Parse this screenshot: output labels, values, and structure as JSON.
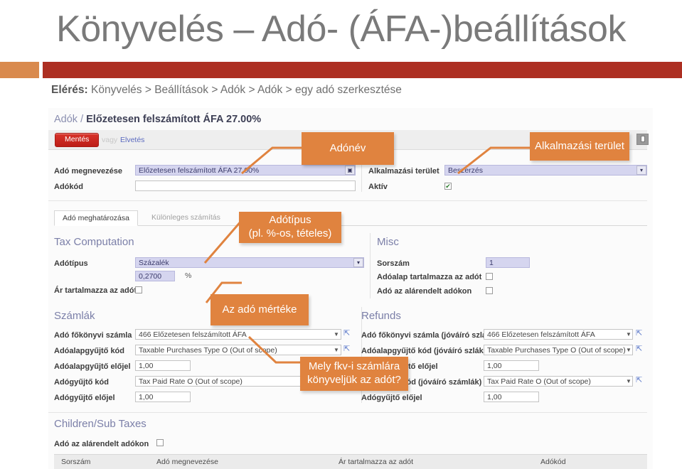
{
  "slide": {
    "title": "Könyvelés – Adó- (ÁFA-)beállítások",
    "access_label": "Elérés:",
    "access_path": "Könyvelés > Beállítások > Adók > Adók > egy adó szerkesztése",
    "accent_color": "#d98a4e",
    "bar_color": "#ad2f22",
    "callout_color": "#e0833f"
  },
  "app": {
    "breadcrumb": {
      "parent": "Adók / ",
      "current": "Előzetesen felszámított ÁFA 27.00%"
    },
    "toolbar": {
      "save_label": "Mentés",
      "or_label": "vagy",
      "discard_label": "Elvetés"
    },
    "header_form": {
      "tax_name_label": "Adó megnevezése",
      "tax_name_value": "Előzetesen felszámított ÁFA 27.00%",
      "tax_code_label": "Adókód",
      "tax_code_value": "",
      "scope_label": "Alkalmazási terület",
      "scope_value": "Beszerzés",
      "active_label": "Aktív",
      "active_checked": "✔"
    },
    "tabs": [
      {
        "label": "Adó meghatározása",
        "active": true
      },
      {
        "label": "Különleges számítás",
        "active": false
      }
    ],
    "tax_computation": {
      "section_title": "Tax Computation",
      "type_label": "Adótípus",
      "type_value": "Százalék",
      "rate_value": "0,2700",
      "rate_unit": "%",
      "price_includes_label": "Ár tartalmazza az adót"
    },
    "misc": {
      "section_title": "Misc",
      "sequence_label": "Sorszám",
      "sequence_value": "1",
      "base_includes_label": "Adóalap tartalmazza az adót",
      "children_label": "Adó az alárendelt adókon"
    },
    "invoices": {
      "section_title": "Számlák",
      "rows": [
        {
          "label": "Adó főkönyvi számla",
          "value": "466 Előzetesen felszámított ÁFA",
          "kind": "select"
        },
        {
          "label": "Adóalapgyűjtő kód",
          "value": "Taxable Purchases Type O (Out of scope)",
          "kind": "select"
        },
        {
          "label": "Adóalapgyűjtő előjel",
          "value": "1,00",
          "kind": "text"
        },
        {
          "label": "Adógyűjtő kód",
          "value": "Tax Paid Rate O (Out of scope)",
          "kind": "select"
        },
        {
          "label": "Adógyűjtő előjel",
          "value": "1,00",
          "kind": "text"
        }
      ]
    },
    "refunds": {
      "section_title": "Refunds",
      "rows": [
        {
          "label": "Adó főkönyvi számla (jóváíró szlák)",
          "value": "466 Előzetesen felszámított ÁFA",
          "kind": "select"
        },
        {
          "label": "Adóalapgyűjtő kód (jóváíró szlák)",
          "value": "Taxable Purchases Type O (Out of scope)",
          "kind": "select"
        },
        {
          "label": "Adóalapgyűjtő előjel",
          "value": "1,00",
          "kind": "text"
        },
        {
          "label": "Adógyűjtő kód (jóváíró számlák)",
          "value": "Tax Paid Rate O (Out of scope)",
          "kind": "select"
        },
        {
          "label": "Adógyűjtő előjel",
          "value": "1,00",
          "kind": "text"
        }
      ]
    },
    "children": {
      "section_title": "Children/Sub Taxes",
      "checkbox_label": "Adó az alárendelt adókon",
      "columns": [
        "Sorszám",
        "Adó megnevezése",
        "Ár tartalmazza az adót",
        "Adókód"
      ]
    }
  },
  "callouts": [
    {
      "id": "tax-name",
      "text": "Adónév"
    },
    {
      "id": "scope",
      "text": "Alkalmazási terület"
    },
    {
      "id": "tax-type",
      "line1": "Adótípus",
      "line2": "(pl. %-os, tételes)"
    },
    {
      "id": "tax-rate",
      "text": "Az adó mértéke"
    },
    {
      "id": "gl-account",
      "line1": "Mely fkv-i számlára",
      "line2": "könyveljük az adót?"
    }
  ]
}
